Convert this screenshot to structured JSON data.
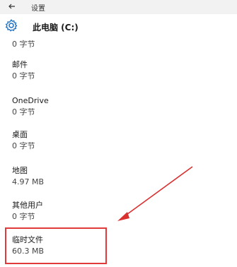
{
  "window": {
    "title": "设置"
  },
  "header": {
    "title": "此电脑 (C:)"
  },
  "items": [
    {
      "label": "",
      "value": "0 字节"
    },
    {
      "label": "邮件",
      "value": "0 字节"
    },
    {
      "label": "OneDrive",
      "value": "0 字节"
    },
    {
      "label": "桌面",
      "value": "0 字节"
    },
    {
      "label": "地图",
      "value": "4.97 MB"
    },
    {
      "label": "其他用户",
      "value": "0 字节"
    },
    {
      "label": "临时文件",
      "value": "60.3 MB"
    }
  ],
  "colors": {
    "highlight": "#e03a3a",
    "arrow": "#d93030"
  }
}
